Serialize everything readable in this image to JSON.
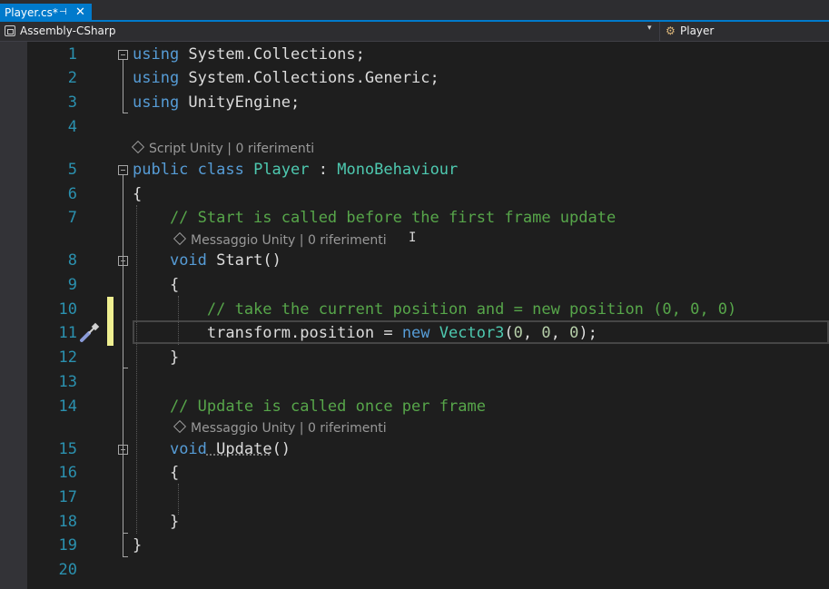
{
  "tab": {
    "title": "Player.cs*",
    "pin": "⊣",
    "close": "✕"
  },
  "navbar": {
    "project": "Assembly-CSharp",
    "dropdown": "▾",
    "member": "Player",
    "member_icon": "⚙"
  },
  "line_numbers": [
    "1",
    "2",
    "3",
    "4",
    "5",
    "6",
    "7",
    "8",
    "9",
    "10",
    "11",
    "12",
    "13",
    "14",
    "15",
    "16",
    "17",
    "18",
    "19",
    "20"
  ],
  "code": {
    "l1": {
      "kw": "using",
      "rest": " System.Collections;"
    },
    "l2": {
      "kw": "using",
      "rest": " System.Collections.Generic;"
    },
    "l3": {
      "kw": "using",
      "rest": " UnityEngine;"
    },
    "l5": {
      "kw1": "public",
      "kw2": " class",
      "type": " Player",
      "colon": " : ",
      "base": "MonoBehaviour"
    },
    "l6": "{",
    "l7": "    // Start is called before the first frame update",
    "l8": {
      "indent": "    ",
      "kw": "void",
      "name": " Start",
      "parens": "()"
    },
    "l9": "    {",
    "l10": "        // take the current position and = new position (0, 0, 0)",
    "l11": {
      "pre": "        transform.position = ",
      "kw": "new",
      "type": " Vector3",
      "args": "(0, 0, 0);"
    },
    "l12": "    }",
    "l14": "    // Update is called once per frame",
    "l15": {
      "indent": "    ",
      "kw": "void",
      "name": " Update",
      "parens": "()"
    },
    "l16": "    {",
    "l18": "    }",
    "l19": "}"
  },
  "codelens": {
    "class": "Script Unity | 0 riferimenti",
    "start": "Messaggio Unity | 0 riferimenti",
    "update": "Messaggio Unity | 0 riferimenti"
  },
  "cursor_glyph": "I",
  "colors": {
    "accent": "#007acc",
    "keyword": "#569cd6",
    "type": "#4ec9b0",
    "comment": "#57a64a",
    "line_number": "#2b91af"
  }
}
